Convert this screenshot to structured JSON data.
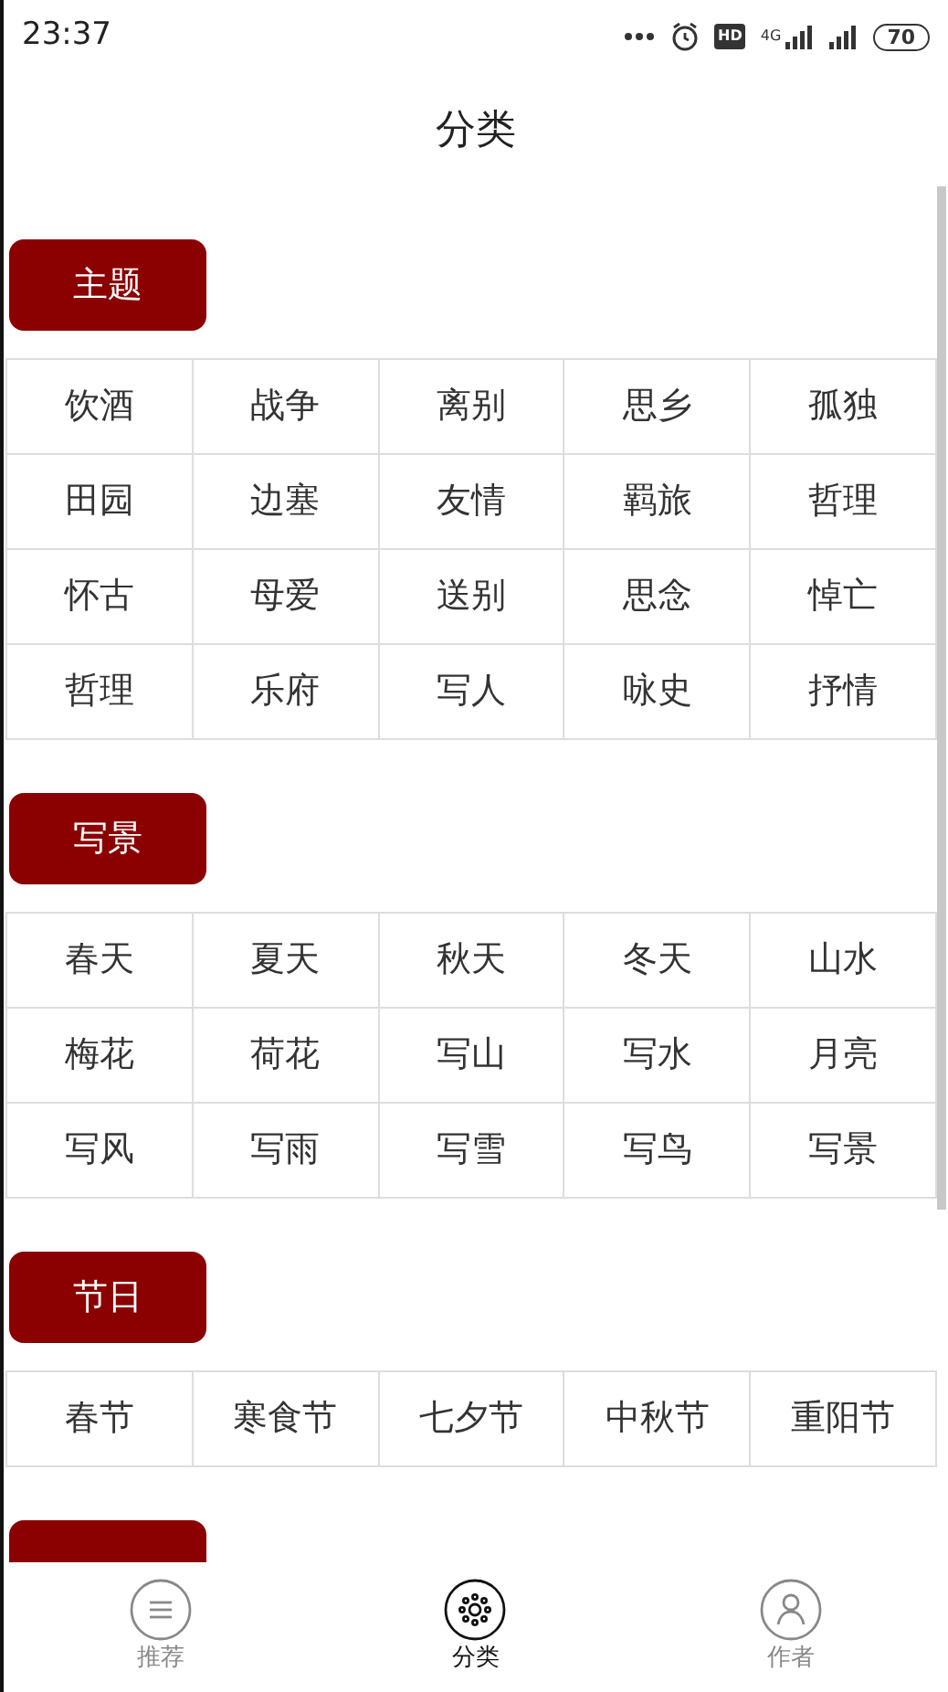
{
  "status_bar": {
    "time": "23:37",
    "hd": "HD",
    "network": "4G",
    "battery": "70"
  },
  "title": "分类",
  "sections": [
    {
      "kind": "full",
      "label": "主题",
      "items": [
        "饮酒",
        "战争",
        "离别",
        "思乡",
        "孤独",
        "田园",
        "边塞",
        "友情",
        "羁旅",
        "哲理",
        "怀古",
        "母爱",
        "送别",
        "思念",
        "悼亡",
        "哲理",
        "乐府",
        "写人",
        "咏史",
        "抒情"
      ]
    },
    {
      "kind": "full",
      "label": "写景",
      "items": [
        "春天",
        "夏天",
        "秋天",
        "冬天",
        "山水",
        "梅花",
        "荷花",
        "写山",
        "写水",
        "月亮",
        "写风",
        "写雨",
        "写雪",
        "写鸟",
        "写景"
      ]
    },
    {
      "kind": "full",
      "label": "节日",
      "items": [
        "春节",
        "寒食节",
        "七夕节",
        "中秋节",
        "重阳节"
      ]
    },
    {
      "kind": "cut"
    }
  ],
  "tabs": [
    {
      "label": "推荐",
      "kind": "list",
      "selected": false
    },
    {
      "label": "分类",
      "kind": "flower",
      "selected": true
    },
    {
      "label": "作者",
      "kind": "person",
      "selected": false
    }
  ]
}
